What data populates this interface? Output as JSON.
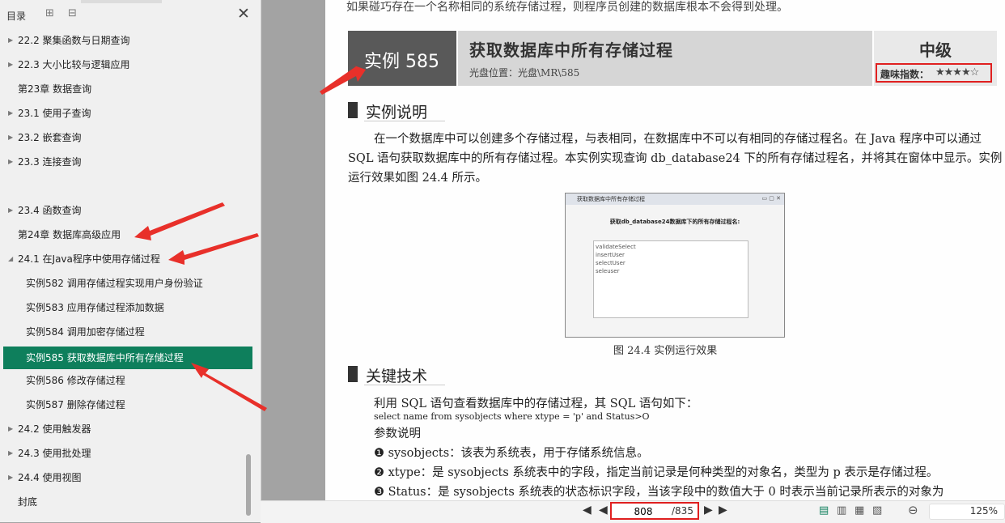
{
  "sidebar": {
    "title": "目录",
    "tool_expand": "⊞",
    "tool_collapse": "⊟",
    "close": "✕",
    "items": [
      {
        "label": "22.2 聚集函数与日期查询",
        "caret": "▶"
      },
      {
        "label": "22.3 大小比较与逻辑应用",
        "caret": "▶"
      },
      {
        "label": "第23章 数据查询",
        "caret": ""
      },
      {
        "label": "23.1 使用子查询",
        "caret": "▶"
      },
      {
        "label": "23.2 嵌套查询",
        "caret": "▶"
      },
      {
        "label": "23.3 连接查询",
        "caret": "▶"
      },
      {
        "label": "23.4 函数查询",
        "caret": "▶"
      },
      {
        "label": "第24章 数据库高级应用",
        "caret": ""
      },
      {
        "label": "24.1 在Java程序中使用存储过程",
        "caret": "◢"
      },
      {
        "label": "实例582 调用存储过程实现用户身份验证",
        "caret": ""
      },
      {
        "label": "实例583 应用存储过程添加数据",
        "caret": ""
      },
      {
        "label": "实例584 调用加密存储过程",
        "caret": ""
      },
      {
        "label": "实例585 获取数据库中所有存储过程",
        "caret": ""
      },
      {
        "label": "实例586 修改存储过程",
        "caret": ""
      },
      {
        "label": "实例587 删除存储过程",
        "caret": ""
      },
      {
        "label": "24.2 使用触发器",
        "caret": "▶"
      },
      {
        "label": "24.3 使用批处理",
        "caret": "▶"
      },
      {
        "label": "24.4 使用视图",
        "caret": "▶"
      },
      {
        "label": "封底",
        "caret": ""
      }
    ]
  },
  "doc": {
    "top_text": "如果碰巧存在一个名称相同的系统存储过程，则程序员创建的数据库根本不会得到处理。",
    "banner": {
      "id": "实例 585",
      "title": "获取数据库中所有存储过程",
      "location": "光盘位置：光盘\\MR\\585",
      "level": "中级",
      "fun_label": "趣味指数：",
      "stars": "★★★★☆"
    },
    "section1": {
      "title": "实例说明",
      "text": "在一个数据库中可以创建多个存储过程，与表相同，在数据库中不可以有相同的存储过程名。在 Java 程序中可以通过 SQL 语句获取数据库中的所有存储过程。本实例实现查询 db_database24 下的所有存储过程名，并将其在窗体中显示。实例运行效果如图 24.4 所示。"
    },
    "figure": {
      "window_title": "获取数据库中所有存储过程",
      "window_controls": "▭ ▢ ✕",
      "label": "获取db_database24数据库下的所有存储过程名:",
      "items": [
        "validateSelect",
        "insertUser",
        "selectUser",
        "seleuser"
      ],
      "caption": "图 24.4   实例运行效果"
    },
    "section2": {
      "title": "关键技术",
      "text": "利用 SQL 语句查看数据库中的存储过程，其 SQL 语句如下：",
      "code": "select name from sysobjects where xtype = 'p' and Status>O",
      "param_title": "参数说明",
      "params": [
        "❶ sysobjects：该表为系统表，用于存储系统信息。",
        "❷ xtype：是 sysobjects 系统表中的字段，指定当前记录是何种类型的对象名，类型为 p 表示是存储过程。",
        "❸ Status：是 sysobjects 系统表的状态标识字段，当该字段中的数值大于 0 时表示当前记录所表示的对象为"
      ]
    }
  },
  "bottom": {
    "first": "◀",
    "prev": "◀",
    "next": "▶",
    "last": "▶",
    "page_current": "808",
    "page_total": "/835",
    "view_single": "▤",
    "view_double": "▥",
    "view_continuous": "▦",
    "view_grid": "▧",
    "zoom_out": "⊖",
    "zoom_level": "125%"
  },
  "colors": {
    "selected_bg": "#0e7f5c",
    "annotation_red": "#e02020"
  }
}
